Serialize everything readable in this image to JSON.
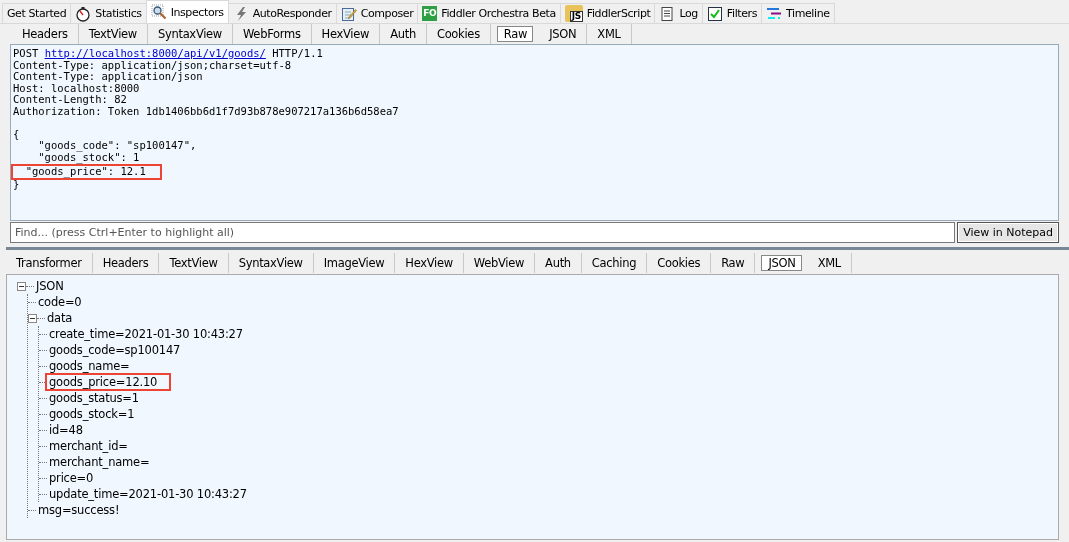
{
  "main_tabs": [
    {
      "label": "Get Started",
      "selected": false
    },
    {
      "label": "Statistics",
      "selected": false
    },
    {
      "label": "Inspectors",
      "selected": true
    },
    {
      "label": "AutoResponder",
      "selected": false
    },
    {
      "label": "Composer",
      "selected": false
    },
    {
      "label": "Fiddler Orchestra Beta",
      "selected": false,
      "icon_text": "FO"
    },
    {
      "label": "FiddlerScript",
      "selected": false,
      "icon_text": "JS"
    },
    {
      "label": "Log",
      "selected": false
    },
    {
      "label": "Filters",
      "selected": false
    },
    {
      "label": "Timeline",
      "selected": false
    }
  ],
  "request": {
    "tabs": [
      {
        "label": "Headers",
        "selected": false
      },
      {
        "label": "TextView",
        "selected": false
      },
      {
        "label": "SyntaxView",
        "selected": false
      },
      {
        "label": "WebForms",
        "selected": false
      },
      {
        "label": "HexView",
        "selected": false
      },
      {
        "label": "Auth",
        "selected": false
      },
      {
        "label": "Cookies",
        "selected": false
      },
      {
        "label": "Raw",
        "selected": true
      },
      {
        "label": "JSON",
        "selected": false
      },
      {
        "label": "XML",
        "selected": false
      }
    ],
    "request_line": {
      "method": "POST",
      "url": "http://localhost:8000/api/v1/goods/",
      "version": "HTTP/1.1"
    },
    "headers": [
      "Content-Type: application/json;charset=utf-8",
      "Content-Type: application/json",
      "Host: localhost:8000",
      "Content-Length: 82",
      "Authorization: Token 1db1406bb6d1f7d93b878e907217a136b6d58ea7"
    ],
    "body_lines": [
      {
        "text": "{",
        "highlighted": false
      },
      {
        "text": "    \"goods_code\": \"sp100147\",",
        "highlighted": false
      },
      {
        "text": "    \"goods_stock\": 1",
        "highlighted": false
      },
      {
        "text": "  \"goods_price\": 12.1",
        "highlighted": true
      },
      {
        "text": "}",
        "highlighted": false
      }
    ],
    "find": {
      "placeholder": "Find... (press Ctrl+Enter to highlight all)"
    },
    "notepad_button": "View in Notepad"
  },
  "response": {
    "tabs": [
      {
        "label": "Transformer",
        "selected": false
      },
      {
        "label": "Headers",
        "selected": false
      },
      {
        "label": "TextView",
        "selected": false
      },
      {
        "label": "SyntaxView",
        "selected": false
      },
      {
        "label": "ImageView",
        "selected": false
      },
      {
        "label": "HexView",
        "selected": false
      },
      {
        "label": "WebView",
        "selected": false
      },
      {
        "label": "Auth",
        "selected": false
      },
      {
        "label": "Caching",
        "selected": false
      },
      {
        "label": "Cookies",
        "selected": false
      },
      {
        "label": "Raw",
        "selected": false
      },
      {
        "label": "JSON",
        "selected": true
      },
      {
        "label": "XML",
        "selected": false
      }
    ],
    "tree": [
      {
        "label": "JSON",
        "expanded": true,
        "highlighted": false,
        "children": [
          {
            "label": "code=0",
            "highlighted": false
          },
          {
            "label": "data",
            "expanded": true,
            "highlighted": false,
            "children": [
              {
                "label": "create_time=2021-01-30 10:43:27",
                "highlighted": false
              },
              {
                "label": "goods_code=sp100147",
                "highlighted": false
              },
              {
                "label": "goods_name=",
                "highlighted": false
              },
              {
                "label": "goods_price=12.10",
                "highlighted": true
              },
              {
                "label": "goods_status=1",
                "highlighted": false
              },
              {
                "label": "goods_stock=1",
                "highlighted": false
              },
              {
                "label": "id=48",
                "highlighted": false
              },
              {
                "label": "merchant_id=",
                "highlighted": false
              },
              {
                "label": "merchant_name=",
                "highlighted": false
              },
              {
                "label": "price=0",
                "highlighted": false
              },
              {
                "label": "update_time=2021-01-30 10:43:27",
                "highlighted": false
              }
            ]
          },
          {
            "label": "msg=success!",
            "highlighted": false
          }
        ]
      }
    ]
  }
}
